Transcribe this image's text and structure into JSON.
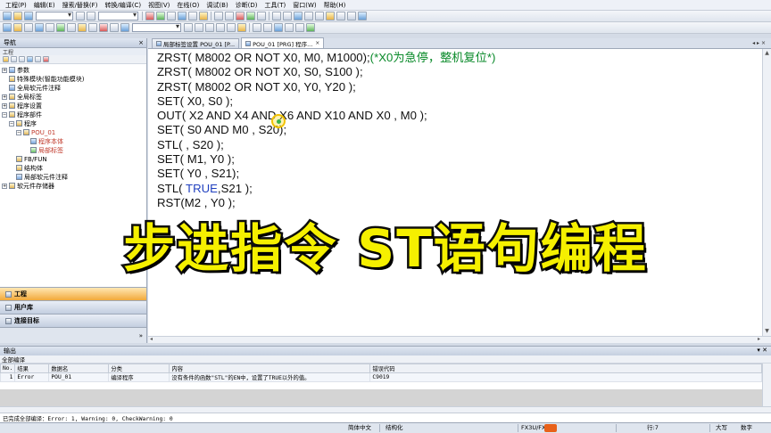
{
  "menu": [
    "工程(P)",
    "编辑(E)",
    "搜索/替换(F)",
    "转换/编译(C)",
    "视图(V)",
    "在线(O)",
    "调试(B)",
    "诊断(D)",
    "工具(T)",
    "窗口(W)",
    "帮助(H)"
  ],
  "nav": {
    "title": "导航",
    "close": "×",
    "section": "工程",
    "tree": [
      {
        "label": "参数",
        "expander": "+"
      },
      {
        "label": "特殊模块(智能功能模块)",
        "expander": ""
      },
      {
        "label": "全局软元件注释",
        "expander": ""
      },
      {
        "label": "全局标签",
        "expander": "+"
      },
      {
        "label": "程序设置",
        "expander": "+"
      },
      {
        "label": "程序部件",
        "expander": "−"
      },
      {
        "label": "程序",
        "expander": "−"
      },
      {
        "label": "POU_01",
        "expander": "−"
      },
      {
        "label": "程序本体",
        "expander": ""
      },
      {
        "label": "局部标签",
        "expander": ""
      },
      {
        "label": "FB/FUN",
        "expander": ""
      },
      {
        "label": "结构体",
        "expander": ""
      },
      {
        "label": "局部软元件注释",
        "expander": ""
      },
      {
        "label": "软元件存储器",
        "expander": "+"
      }
    ],
    "bottom_buttons": [
      "工程",
      "用户库",
      "连接目标"
    ],
    "bottom_more": "»"
  },
  "tabs": [
    {
      "label": "局部标签设置 POU_01 [P...",
      "close": ""
    },
    {
      "label": "POU_01 [PRG] 程序...",
      "close": "×"
    }
  ],
  "tab_scroll": "◂ ▸ ×",
  "code_lines": [
    {
      "code": "ZRST( M8002 OR NOT X0, M0, M1000);",
      "comment": "(*X0为急停，整机复位*)"
    },
    {
      "code": "ZRST( M8002 OR NOT X0, S0, S100 );"
    },
    {
      "code": "ZRST( M8002 OR NOT X0, Y0, Y20 );"
    },
    {
      "code": "SET( X0, S0 );"
    },
    {
      "code": "OUT( X2 AND X4 AND X6 AND X10 AND X0 , M0 );"
    },
    {
      "code": "SET( S0 AND M0 , S20);"
    },
    {
      "code": "STL( , S20 );"
    },
    {
      "code": "SET( M1, Y0 );"
    },
    {
      "code": "SET( Y0 , S21);"
    },
    {
      "code": "STL( ",
      "keyword": "TRUE",
      "after": ",S21 );"
    },
    {
      "code": "RST(M2 , Y0 );"
    }
  ],
  "overlay_title": "步进指令 ST语句编程",
  "output": {
    "title": "输出",
    "controls": "▾ ✕",
    "subtitle": "全部编译",
    "columns": [
      "No.",
      "结果",
      "数据名",
      "分类",
      "内容",
      "错误代码"
    ],
    "rows": [
      [
        "1",
        "Error",
        "POU_01",
        "编译程序",
        "没有条件的函数\"STL\"的EN中，设置了TRUE以外的值。",
        "C9019"
      ]
    ],
    "summary": "已完成全部编译：Error: 1, Warning: 0, CheckWarning: 0"
  },
  "status": {
    "language": "简体中文",
    "mode": "结构化",
    "plc": "FX3U/FX",
    "row": "行:7",
    "caps": "大写",
    "num": "数字"
  }
}
